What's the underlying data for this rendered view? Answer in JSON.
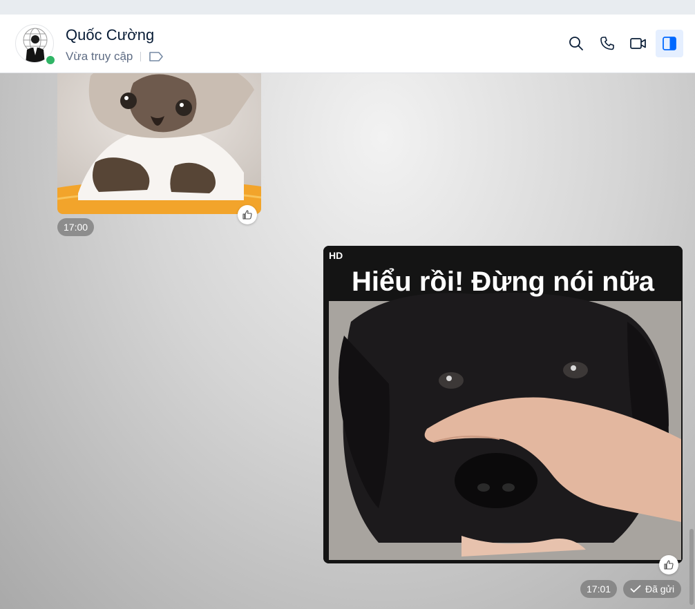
{
  "contact": {
    "name": "Quốc Cường",
    "status": "Vừa truy cập",
    "online": true
  },
  "header_actions": [
    {
      "icon": "search-icon"
    },
    {
      "icon": "phone-icon"
    },
    {
      "icon": "video-call-icon"
    },
    {
      "icon": "sidebar-toggle-icon",
      "active": true
    }
  ],
  "messages": {
    "incoming": {
      "content": "cat-photo",
      "time": "17:00"
    },
    "outgoing": {
      "content": "dog-meme-photo",
      "badge": "HD",
      "caption": "Hiểu rồi! Đừng nói nữa",
      "time": "17:01",
      "delivery_status": "Đã gửi"
    }
  },
  "colors": {
    "accent": "#0068ff",
    "online": "#30b566",
    "name_text": "#081c36",
    "status_text": "#5e6c84"
  }
}
